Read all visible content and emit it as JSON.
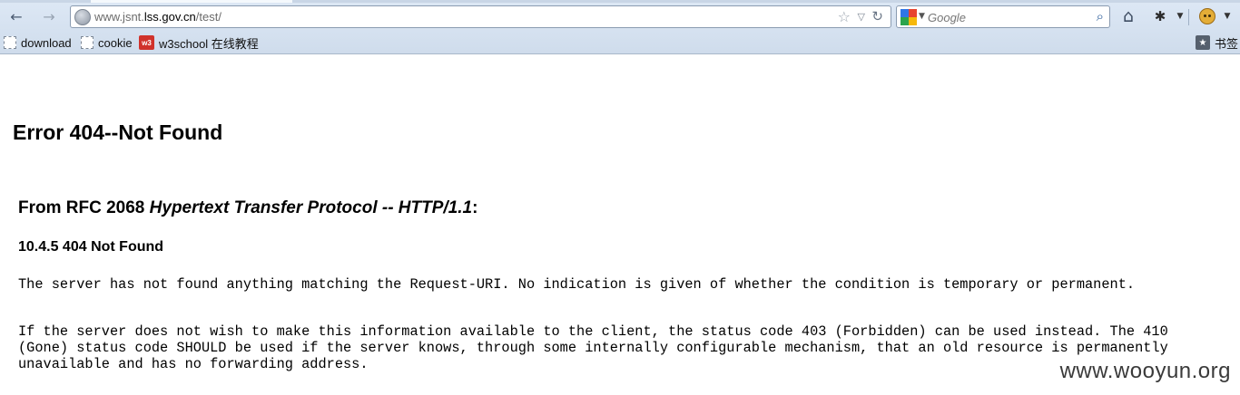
{
  "browser": {
    "back_label": "◀",
    "forward_label": "▶",
    "url_host_prefix": "www.jsnt.",
    "url_host": "lss.gov.cn",
    "url_path": "/test/",
    "search_placeholder": "Google",
    "bookmarks": [
      {
        "label": "download",
        "icon": "dashed-page-icon"
      },
      {
        "label": "cookie",
        "icon": "dashed-page-icon"
      },
      {
        "label": "w3school 在线教程",
        "icon": "w3-icon"
      }
    ],
    "library_label": "书签"
  },
  "page": {
    "error_title": "Error 404--Not Found",
    "rfc_prefix": "From RFC 2068 ",
    "rfc_title": "Hypertext Transfer Protocol -- HTTP/1.1",
    "rfc_suffix": ":",
    "section_heading": "10.4.5 404 Not Found",
    "paragraph_1": "The server has not found anything matching the Request-URI. No indication is given of whether the condition is temporary or permanent.",
    "paragraph_2": "If the server does not wish to make this information available to the client, the status code 403 (Forbidden) can be used instead. The 410 (Gone) status code SHOULD be used if the server knows, through some internally configurable mechanism, that an old resource is permanently unavailable and has no forwarding address."
  },
  "watermark": "www.wooyun.org",
  "colors": {
    "chrome_bg": "#d6e2f0",
    "w3_icon": "#d0322b"
  }
}
